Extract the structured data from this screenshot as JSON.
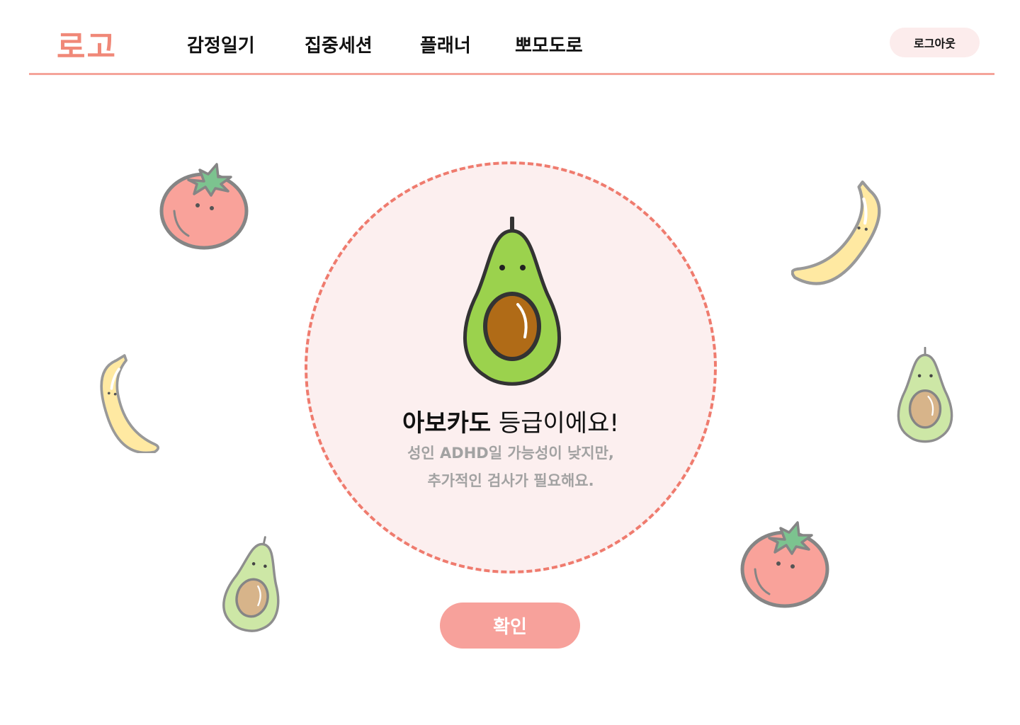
{
  "header": {
    "logo": "로고",
    "nav": [
      {
        "label": "감정일기"
      },
      {
        "label": "집중세션"
      },
      {
        "label": "플래너"
      },
      {
        "label": "뽀모도로"
      }
    ],
    "logout_label": "로그아웃"
  },
  "result": {
    "grade": "아보카도",
    "grade_suffix": " 등급이에요!",
    "description_line1": "성인 ADHD일 가능성이 낮지만,",
    "description_line2": "추가적인 검사가 필요해요."
  },
  "confirm_label": "확인",
  "decorations": [
    "tomato-icon",
    "banana-icon",
    "avocado-icon"
  ],
  "colors": {
    "accent": "#f08878",
    "divider": "#f5a49a",
    "circle_fill": "#fcefef",
    "circle_border": "#ef7b6e",
    "button": "#f7a19b",
    "muted_text": "#a2a2a2"
  }
}
